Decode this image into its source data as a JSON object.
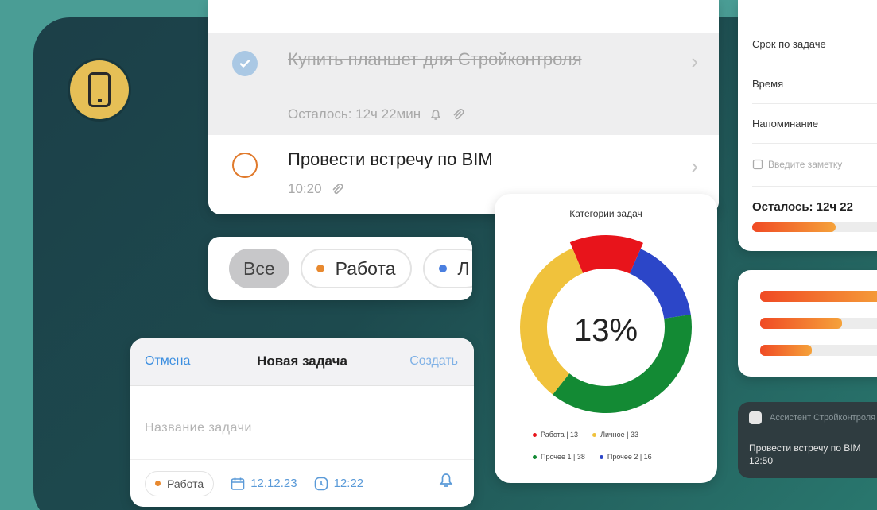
{
  "tasks": [
    {
      "title": "Купить планшет для Стройконтроля",
      "meta": "Осталось: 12ч 22мин",
      "done": true
    },
    {
      "title": "Провести встречу по BIM",
      "meta": "10:20",
      "done": false
    }
  ],
  "filters": {
    "all": "Все",
    "work": "Работа",
    "third": "Л"
  },
  "new_task": {
    "cancel": "Отмена",
    "title": "Новая задача",
    "create": "Создать",
    "placeholder": "Название задачи",
    "category": "Работа",
    "date": "12.12.23",
    "time": "12:22"
  },
  "chart_data": {
    "type": "pie",
    "title": "Категории задач",
    "center_label": "13%",
    "series": [
      {
        "name": "Работа",
        "value": 13,
        "color": "#e8141b"
      },
      {
        "name": "Прочее 2",
        "value": 16,
        "color": "#2c46c8"
      },
      {
        "name": "Прочее 1",
        "value": 38,
        "color": "#138a34"
      },
      {
        "name": "Личное",
        "value": 33,
        "color": "#f0c23c"
      }
    ],
    "legend": [
      {
        "label": "Работа | 13",
        "color": "#e8141b"
      },
      {
        "label": "Личное | 33",
        "color": "#f0c23c"
      },
      {
        "label": "Прочее 1 | 38",
        "color": "#138a34"
      },
      {
        "label": "Прочее 2 | 16",
        "color": "#2c46c8"
      }
    ]
  },
  "details": {
    "deadline": "Срок по задаче",
    "time": "Время",
    "reminder": "Напоминание",
    "note": "Введите заметку",
    "remaining": "Осталось: 12ч 22",
    "remaining_progress": 0.55
  },
  "progress_bars": [
    0.95,
    0.6,
    0.38
  ],
  "notification": {
    "app": "Ассистент Стройконтроля",
    "text": "Провести встречу по BIM",
    "time": "12:50"
  },
  "colors": {
    "accent_orange": "#e07a2c",
    "link_blue": "#3b8ee0",
    "background": "#4a9d95"
  }
}
